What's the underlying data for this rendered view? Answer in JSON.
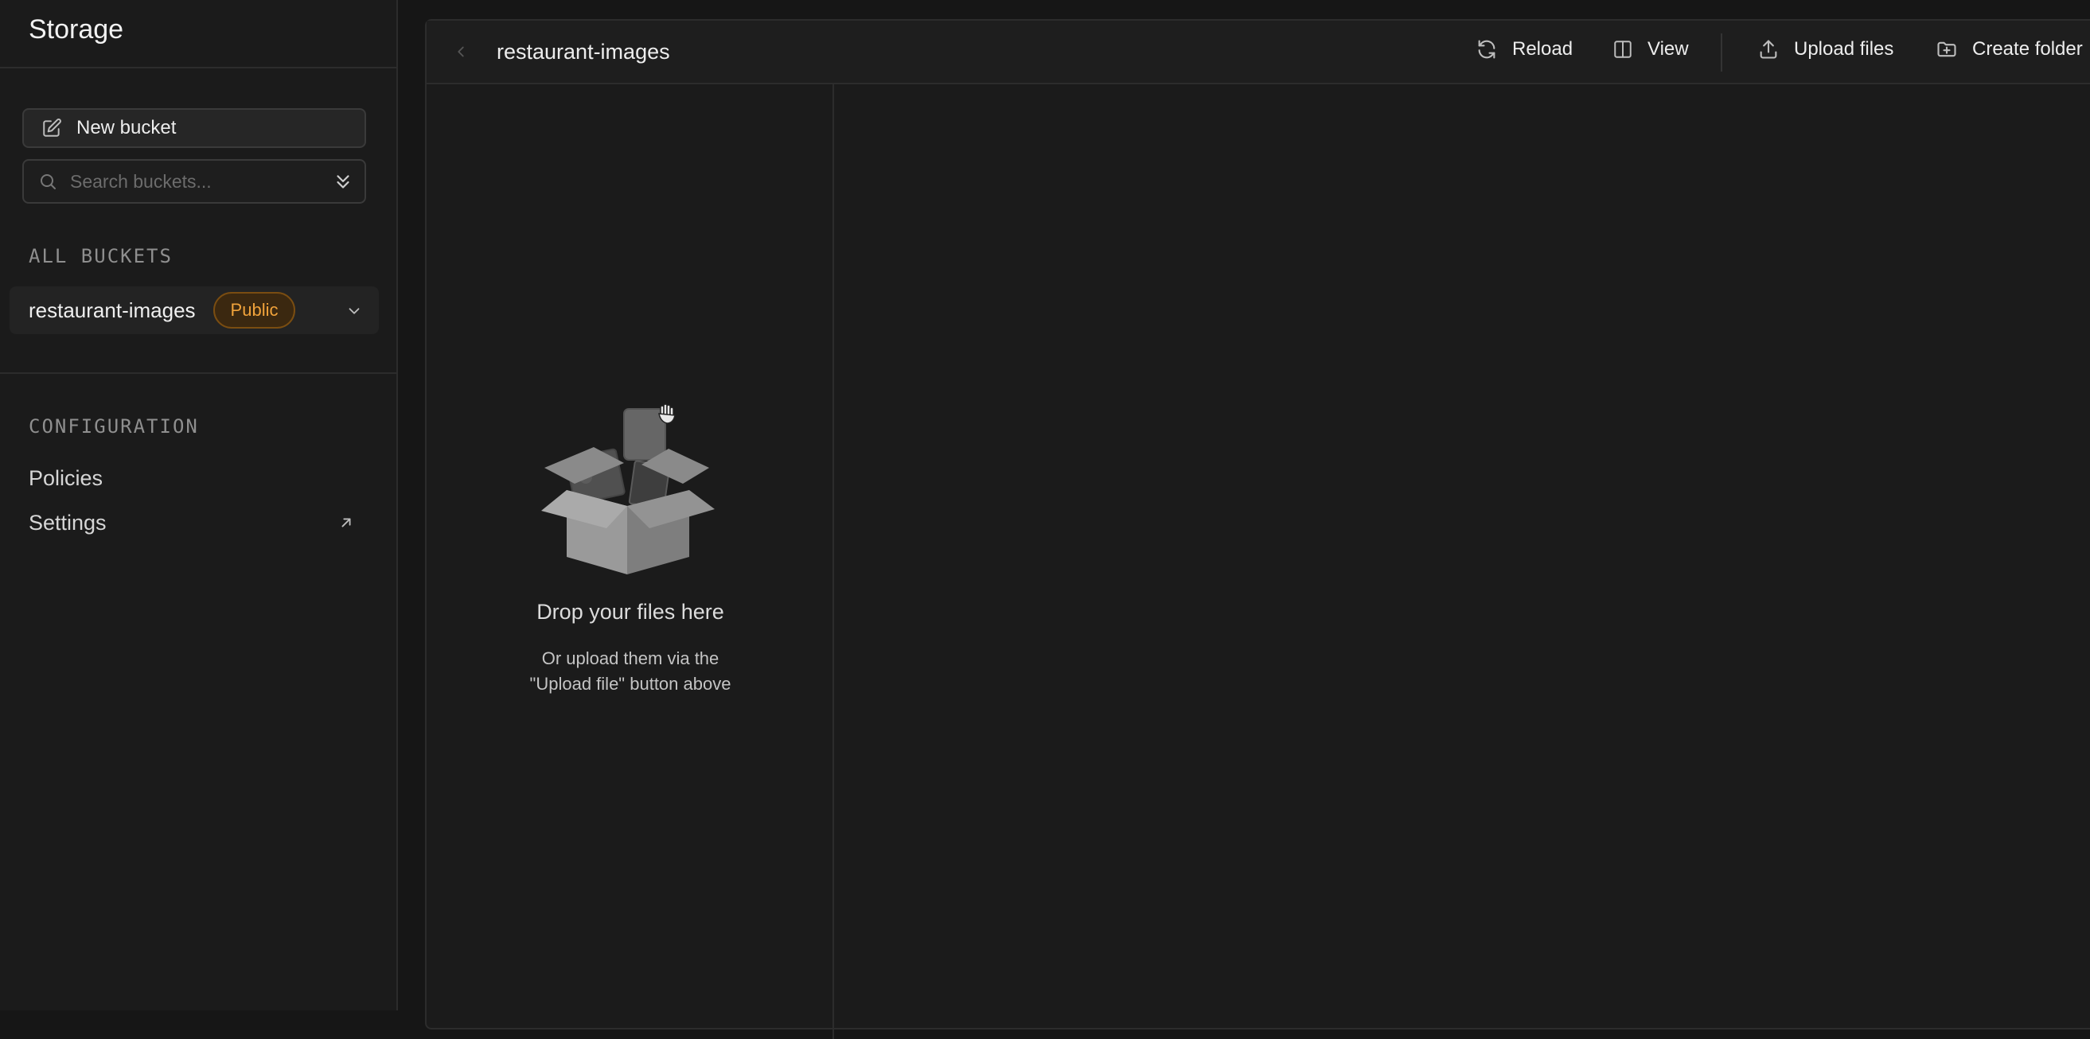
{
  "sidebar": {
    "title": "Storage",
    "new_bucket_label": "New bucket",
    "search_placeholder": "Search buckets...",
    "all_buckets_label": "ALL BUCKETS",
    "buckets": [
      {
        "name": "restaurant-images",
        "badge": "Public"
      }
    ],
    "configuration_label": "CONFIGURATION",
    "config_links": [
      {
        "label": "Policies"
      },
      {
        "label": "Settings"
      }
    ]
  },
  "toolbar": {
    "bucket_title": "restaurant-images",
    "reload_label": "Reload",
    "view_label": "View",
    "upload_label": "Upload files",
    "create_folder_label": "Create folder"
  },
  "empty_state": {
    "title": "Drop your files here",
    "subtitle_line1": "Or upload them via the",
    "subtitle_line2": "\"Upload file\" button above"
  },
  "colors": {
    "background": "#161616",
    "badge_text": "#f1a33b",
    "badge_border": "#7a4d11"
  }
}
